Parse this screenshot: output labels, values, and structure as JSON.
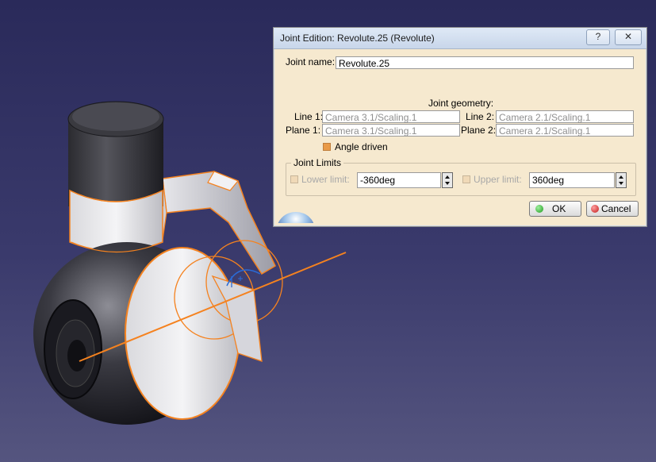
{
  "dialog": {
    "title": "Joint Edition: Revolute.25 (Revolute)",
    "help_glyph": "?",
    "close_glyph": "✕",
    "joint_name_label": "Joint name:",
    "joint_name_value": "Revolute.25",
    "geometry_label": "Joint geometry:",
    "line1_label": "Line 1:",
    "line1_value": "Camera 3.1/Scaling.1",
    "line2_label": "Line 2:",
    "line2_value": "Camera 2.1/Scaling.1",
    "plane1_label": "Plane 1:",
    "plane1_value": "Camera 3.1/Scaling.1",
    "plane2_label": "Plane 2:",
    "plane2_value": "Camera 2.1/Scaling.1",
    "angle_driven_label": "Angle driven",
    "angle_driven_checked": true,
    "limits_title": "Joint Limits",
    "lower_limit_label": "Lower limit:",
    "lower_limit_value": "-360deg",
    "upper_limit_label": "Upper limit:",
    "upper_limit_value": "360deg",
    "ok_label": "OK",
    "cancel_label": "Cancel"
  },
  "colors": {
    "dialog_bg": "#f6e9cf",
    "selection_orange": "#f5821f",
    "axis_blue": "#2a6bd8",
    "background_top": "#2a2a5a",
    "background_bottom": "#55557f"
  }
}
